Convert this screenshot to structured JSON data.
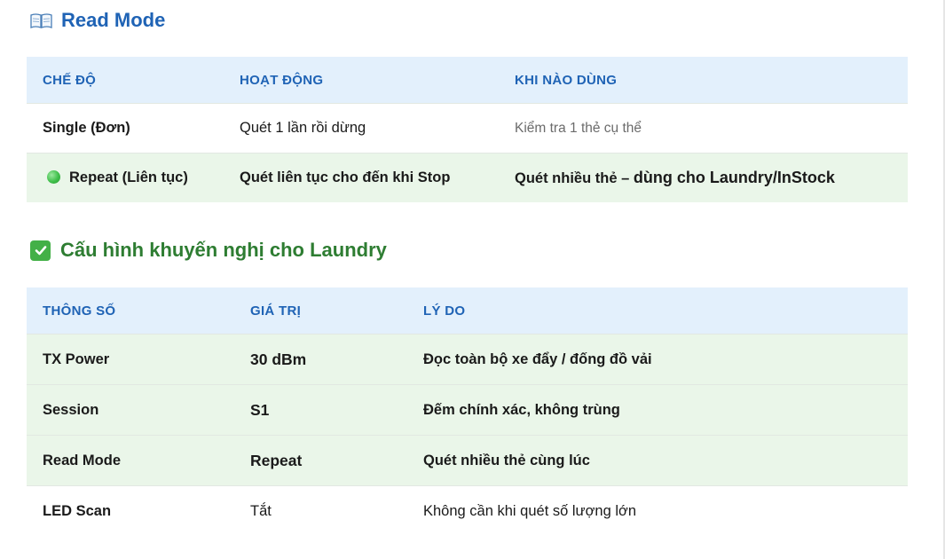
{
  "read_mode": {
    "title": "Read Mode",
    "headers": [
      "CHẾ ĐỘ",
      "HOẠT ĐỘNG",
      "KHI NÀO DÙNG"
    ],
    "rows": [
      {
        "mode": "Single (Đơn)",
        "action": "Quét 1 lần rồi dừng",
        "when": "Kiểm tra 1 thẻ cụ thể"
      },
      {
        "mode": "Repeat (Liên tục)",
        "action": "Quét liên tục cho đến khi Stop",
        "when_prefix": "Quét nhiều thẻ – ",
        "when_strong": "dùng cho Laundry/InStock"
      }
    ]
  },
  "laundry_config": {
    "title": "Cấu hình khuyến nghị cho Laundry",
    "headers": [
      "THÔNG SỐ",
      "GIÁ TRỊ",
      "LÝ DO"
    ],
    "rows": [
      {
        "param": "TX Power",
        "value": "30 dBm",
        "reason": "Đọc toàn bộ xe đẩy / đống đồ vải"
      },
      {
        "param": "Session",
        "value": "S1",
        "reason": "Đếm chính xác, không trùng"
      },
      {
        "param": "Read Mode",
        "value": "Repeat",
        "reason": "Quét nhiều thẻ cùng lúc"
      },
      {
        "param": "LED Scan",
        "value": "Tắt",
        "reason": "Không cần khi quét số lượng lớn"
      }
    ]
  }
}
